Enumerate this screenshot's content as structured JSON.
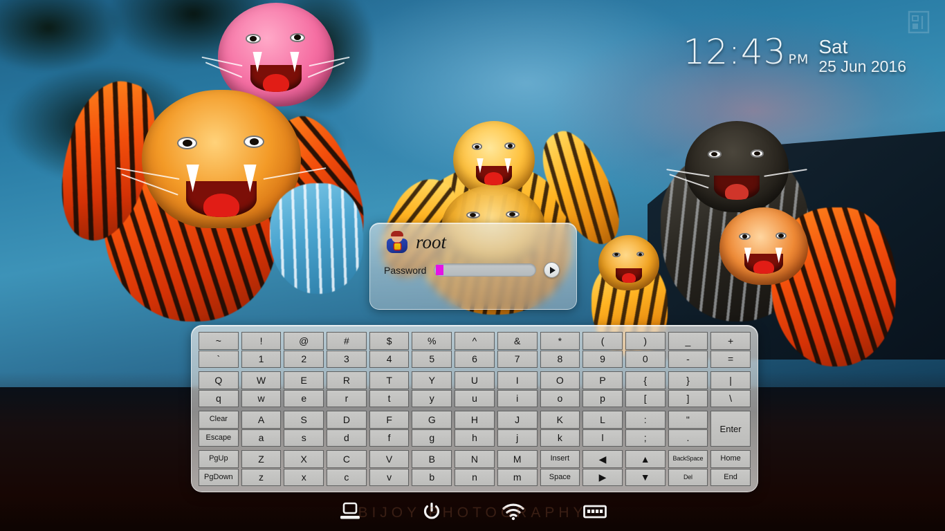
{
  "screen": {
    "type": "linux-login-screen",
    "background_description": "Pulikali tiger dance performers, Kerala festival, night sky"
  },
  "clock": {
    "time": "12:43",
    "ampm": "PM",
    "day_of_week": "Sat",
    "date": "25 Jun 2016"
  },
  "watermark": {
    "corner_logo": "house-logo-icon",
    "backdrop_text": "BIJOY PHOTOGRAPHY"
  },
  "login": {
    "avatar_icon": "superman-avatar-icon",
    "username": "root",
    "password_label": "Password",
    "password_value": "",
    "cursor_color": "#e513e5",
    "submit_icon": "play-arrow-icon"
  },
  "keyboard": {
    "rows": [
      [
        {
          "upper": "~",
          "lower": "`"
        },
        {
          "upper": "!",
          "lower": "1"
        },
        {
          "upper": "@",
          "lower": "2"
        },
        {
          "upper": "#",
          "lower": "3"
        },
        {
          "upper": "$",
          "lower": "4"
        },
        {
          "upper": "%",
          "lower": "5"
        },
        {
          "upper": "^",
          "lower": "6"
        },
        {
          "upper": "&",
          "lower": "7"
        },
        {
          "upper": "*",
          "lower": "8"
        },
        {
          "upper": "(",
          "lower": "9"
        },
        {
          "upper": ")",
          "lower": "0"
        },
        {
          "upper": "_",
          "lower": "-"
        },
        {
          "upper": "+",
          "lower": "="
        }
      ],
      [
        {
          "upper": "Q",
          "lower": "q"
        },
        {
          "upper": "W",
          "lower": "w"
        },
        {
          "upper": "E",
          "lower": "e"
        },
        {
          "upper": "R",
          "lower": "r"
        },
        {
          "upper": "T",
          "lower": "t"
        },
        {
          "upper": "Y",
          "lower": "y"
        },
        {
          "upper": "U",
          "lower": "u"
        },
        {
          "upper": "I",
          "lower": "i"
        },
        {
          "upper": "O",
          "lower": "o"
        },
        {
          "upper": "P",
          "lower": "p"
        },
        {
          "upper": "{",
          "lower": "["
        },
        {
          "upper": "}",
          "lower": "]"
        },
        {
          "upper": "|",
          "lower": "\\"
        }
      ],
      [
        {
          "upper": "Clear",
          "lower": "Escape",
          "size": "sm"
        },
        {
          "upper": "A",
          "lower": "a"
        },
        {
          "upper": "S",
          "lower": "s"
        },
        {
          "upper": "D",
          "lower": "d"
        },
        {
          "upper": "F",
          "lower": "f"
        },
        {
          "upper": "G",
          "lower": "g"
        },
        {
          "upper": "H",
          "lower": "h"
        },
        {
          "upper": "J",
          "lower": "j"
        },
        {
          "upper": "K",
          "lower": "k"
        },
        {
          "upper": "L",
          "lower": "l"
        },
        {
          "upper": ":",
          "lower": ";"
        },
        {
          "upper": "\"",
          "lower": "."
        },
        {
          "single": "Enter"
        }
      ],
      [
        {
          "upper": "PgUp",
          "lower": "PgDown",
          "size": "sm"
        },
        {
          "upper": "Z",
          "lower": "z"
        },
        {
          "upper": "X",
          "lower": "x"
        },
        {
          "upper": "C",
          "lower": "c"
        },
        {
          "upper": "V",
          "lower": "v"
        },
        {
          "upper": "B",
          "lower": "b"
        },
        {
          "upper": "N",
          "lower": "n"
        },
        {
          "upper": "M",
          "lower": "m"
        },
        {
          "upper": "Insert",
          "lower": "Space",
          "size": "sm"
        },
        {
          "upper": "◀",
          "lower": "▶"
        },
        {
          "upper": "▲",
          "lower": "▼"
        },
        {
          "upper": "BackSpace",
          "lower": "Del",
          "size": "tiny"
        },
        {
          "upper": "Home",
          "lower": "End",
          "size": "sm"
        }
      ]
    ]
  },
  "taskbar": {
    "items": [
      {
        "icon": "monitor-icon",
        "name": "display-session-button"
      },
      {
        "icon": "power-icon",
        "name": "power-button"
      },
      {
        "icon": "wifi-icon",
        "name": "network-button"
      },
      {
        "icon": "keyboard-icon",
        "name": "virtual-keyboard-toggle"
      }
    ]
  }
}
